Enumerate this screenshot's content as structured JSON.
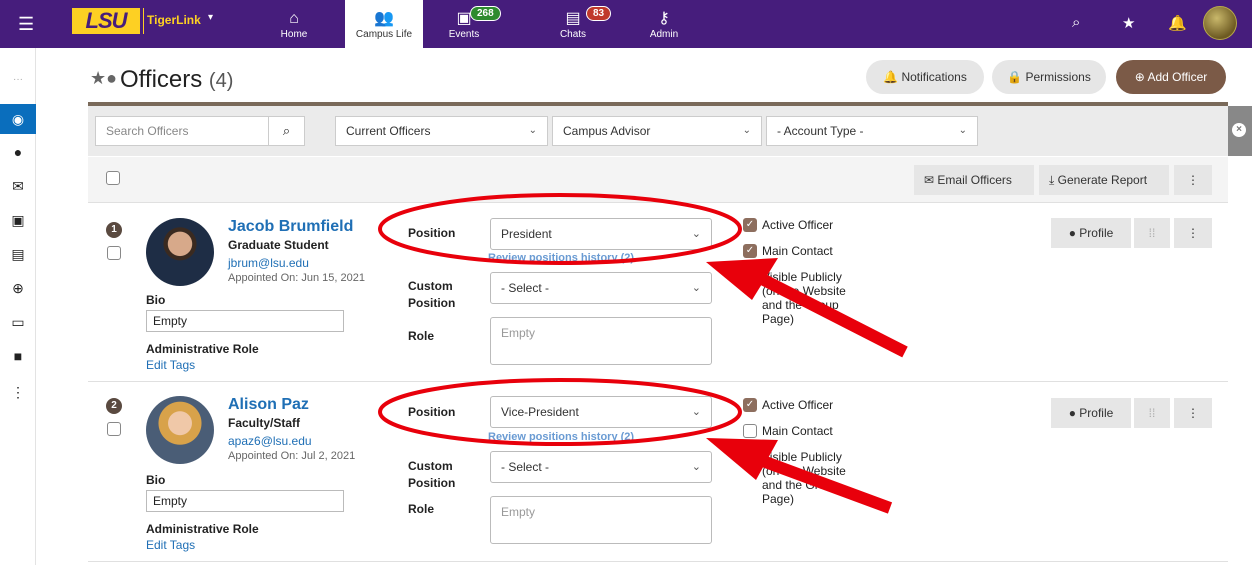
{
  "topbar": {
    "brand": "TigerLink",
    "logo": "LSU",
    "nav": [
      {
        "label": "Home",
        "icon": "home-icon"
      },
      {
        "label": "Campus Life",
        "icon": "people-icon"
      },
      {
        "label": "Events",
        "icon": "calendar-icon",
        "badge": "268"
      },
      {
        "label": "Chats",
        "icon": "chat-icon",
        "badge": "83"
      },
      {
        "label": "Admin",
        "icon": "key-icon"
      }
    ]
  },
  "page": {
    "title": "Officers",
    "count": "(4)",
    "notifications_label": "Notifications",
    "permissions_label": "Permissions",
    "add_label": "Add Officer"
  },
  "filters": {
    "search_placeholder": "Search Officers",
    "status": "Current Officers",
    "advisor": "Campus Advisor",
    "account_type": "- Account Type -"
  },
  "toolbar": {
    "email_label": "Email Officers",
    "report_label": "Generate Report"
  },
  "officers": [
    {
      "num": "1",
      "name": "Jacob Brumfield",
      "role": "Graduate Student",
      "email": "jbrum@lsu.edu",
      "appointed": "Appointed On: Jun 15, 2021",
      "bio_label": "Bio",
      "bio": "Empty",
      "admin_role_label": "Administrative Role",
      "edit_tags": "Edit Tags",
      "position_label": "Position",
      "position": "President",
      "history": "Review positions history (2)",
      "custom_label_1": "Custom",
      "custom_label_2": "Position",
      "custom": "- Select -",
      "role_label": "Role",
      "role_value": "Empty",
      "active_officer": "Active Officer",
      "main_contact": "Main Contact",
      "visible_1": "Visible Publicly",
      "visible_2": "(on the Website",
      "visible_3": "and the Group",
      "visible_4": "Page)",
      "profile_label": "Profile"
    },
    {
      "num": "2",
      "name": "Alison Paz",
      "role": "Faculty/Staff",
      "email": "apaz6@lsu.edu",
      "appointed": "Appointed On: Jul 2, 2021",
      "bio_label": "Bio",
      "bio": "Empty",
      "admin_role_label": "Administrative Role",
      "edit_tags": "Edit Tags",
      "position_label": "Position",
      "position": "Vice-President",
      "history": "Review positions history (2)",
      "custom_label_1": "Custom",
      "custom_label_2": "Position",
      "custom": "- Select -",
      "role_label": "Role",
      "role_value": "Empty",
      "active_officer": "Active Officer",
      "main_contact": "Main Contact",
      "visible_1": "Visible Publicly",
      "visible_2": "(on the Website",
      "visible_3": "and the Group",
      "visible_4": "Page)",
      "profile_label": "Profile"
    }
  ],
  "colors": {
    "nav_bg": "#461d7c",
    "logo_gold": "#fdd023",
    "accent_brown": "#7b5a47",
    "link_blue": "#1f6fb5",
    "annotation_red": "#e8000b"
  }
}
